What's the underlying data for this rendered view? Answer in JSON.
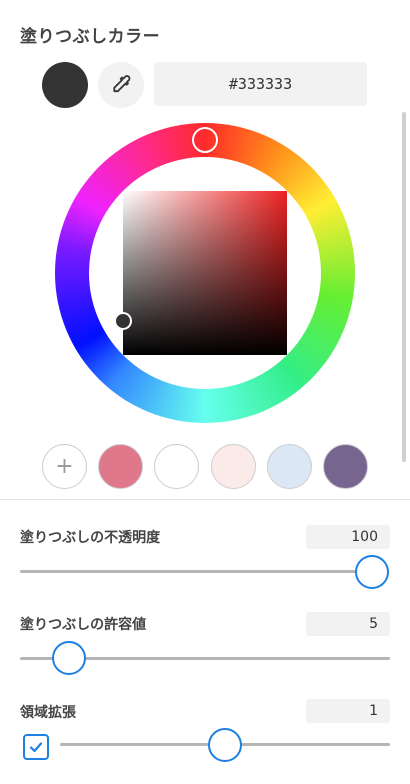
{
  "panel": {
    "title": "塗りつぶしカラー",
    "current_color": "#333333",
    "hex_value": "#333333"
  },
  "picker": {
    "hue_color": "#ee2222"
  },
  "presets": {
    "add_label": "+",
    "colors": [
      "#df788b",
      "#ffffff",
      "#fbebe8",
      "#dbe7f4",
      "#776590"
    ]
  },
  "settings": {
    "opacity": {
      "label": "塗りつぶしの不透明度",
      "value": "100",
      "level": 1.0
    },
    "tolerance": {
      "label": "塗りつぶしの許容値",
      "value": "5",
      "level": 0.05
    },
    "expand": {
      "label": "領域拡張",
      "value": "1",
      "enabled": true,
      "level": 0.5
    }
  },
  "accent_color": "#1e80e0"
}
